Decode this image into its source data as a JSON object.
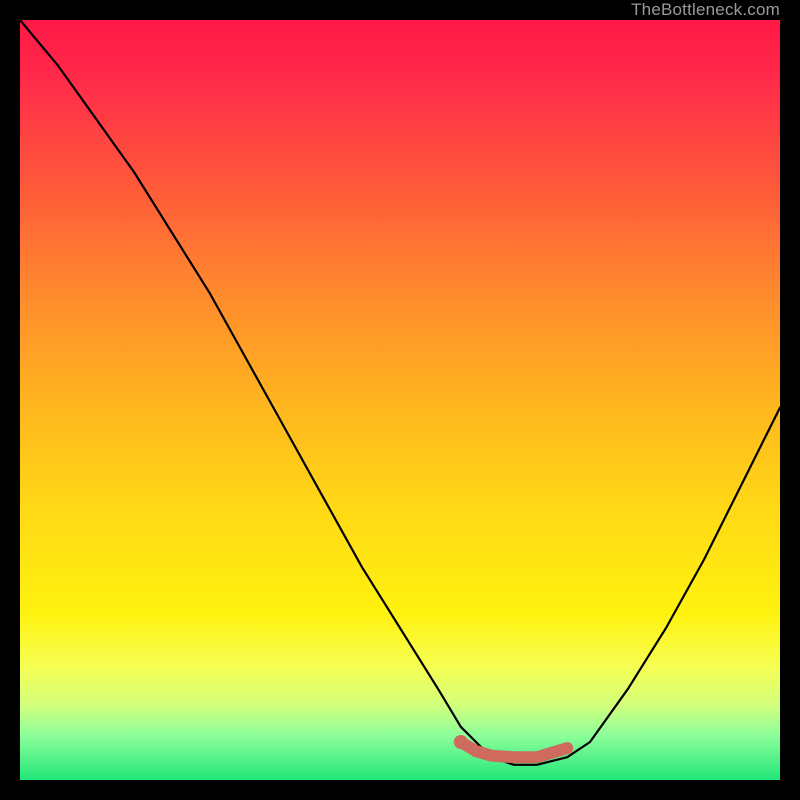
{
  "watermark": "TheBottleneck.com",
  "colors": {
    "frame": "#000000",
    "curve": "#000000",
    "highlight": "#cf6a5f",
    "gradient_top": "#ff1846",
    "gradient_bottom": "#22e67a"
  },
  "chart_data": {
    "type": "line",
    "title": "",
    "xlabel": "",
    "ylabel": "",
    "xlim": [
      0,
      100
    ],
    "ylim": [
      0,
      100
    ],
    "series": [
      {
        "name": "bottleneck-curve",
        "x": [
          0,
          5,
          10,
          15,
          20,
          25,
          30,
          35,
          40,
          45,
          50,
          55,
          58,
          60,
          62,
          65,
          68,
          72,
          75,
          80,
          85,
          90,
          95,
          100
        ],
        "y": [
          100,
          94,
          87,
          80,
          72,
          64,
          55,
          46,
          37,
          28,
          20,
          12,
          7,
          5,
          3,
          2,
          2,
          3,
          5,
          12,
          20,
          29,
          39,
          49
        ]
      },
      {
        "name": "highlight-segment",
        "x": [
          58,
          60,
          62,
          65,
          68,
          72
        ],
        "y": [
          5,
          3.8,
          3.2,
          3.0,
          3.0,
          4.2
        ]
      }
    ],
    "highlight_point": {
      "x": 58,
      "y": 5
    }
  }
}
